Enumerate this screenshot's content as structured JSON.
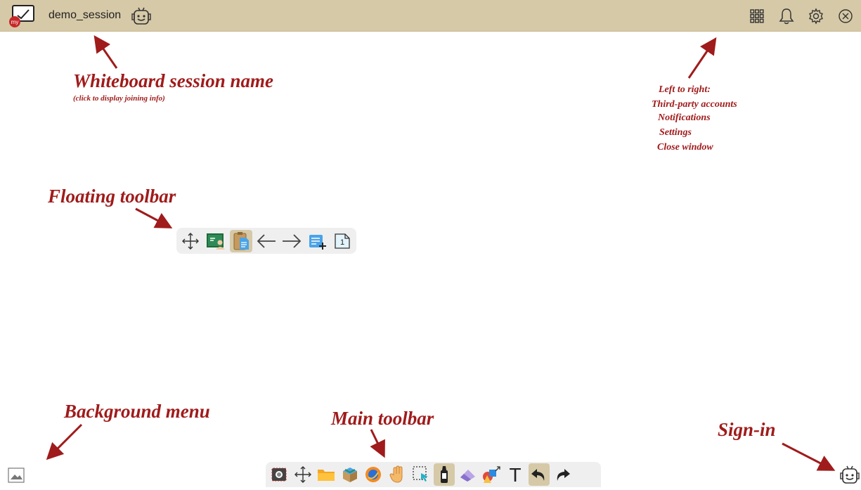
{
  "header": {
    "session_name": "demo_session",
    "logo_badge": "my",
    "icons": [
      "app-logo-icon",
      "bot-icon",
      "grid-icon",
      "bell-icon",
      "gear-icon",
      "close-circle-icon"
    ]
  },
  "annotations": {
    "session_title": "Whiteboard session name",
    "session_subtitle": "(click to display joining info)",
    "right_lines": [
      "Left to right:",
      "Third-party accounts",
      "Notifications",
      "Settings",
      "Close window"
    ],
    "floating_toolbar": "Floating toolbar",
    "background_menu": "Background menu",
    "main_toolbar": "Main toolbar",
    "sign_in": "Sign-in"
  },
  "floating_toolbar": {
    "page_number": "1",
    "items": [
      "move-icon",
      "presentation-icon",
      "clipboard-icon",
      "arrow-left-icon",
      "arrow-right-icon",
      "add-page-icon",
      "page-number-icon"
    ],
    "active": "clipboard-icon"
  },
  "main_toolbar": {
    "items": [
      "screenshot-icon",
      "move-icon",
      "folder-icon",
      "box-icon",
      "browser-icon",
      "hand-icon",
      "select-icon",
      "marker-icon",
      "eraser-icon",
      "shapes-icon",
      "text-icon",
      "undo-icon",
      "redo-icon"
    ],
    "active": [
      "marker-icon",
      "undo-icon"
    ],
    "text_tool_glyph": "T"
  },
  "colors": {
    "topbar": "#d6c9a7",
    "annotation": "#a01b1b",
    "toolbar_bg": "#efefef"
  }
}
